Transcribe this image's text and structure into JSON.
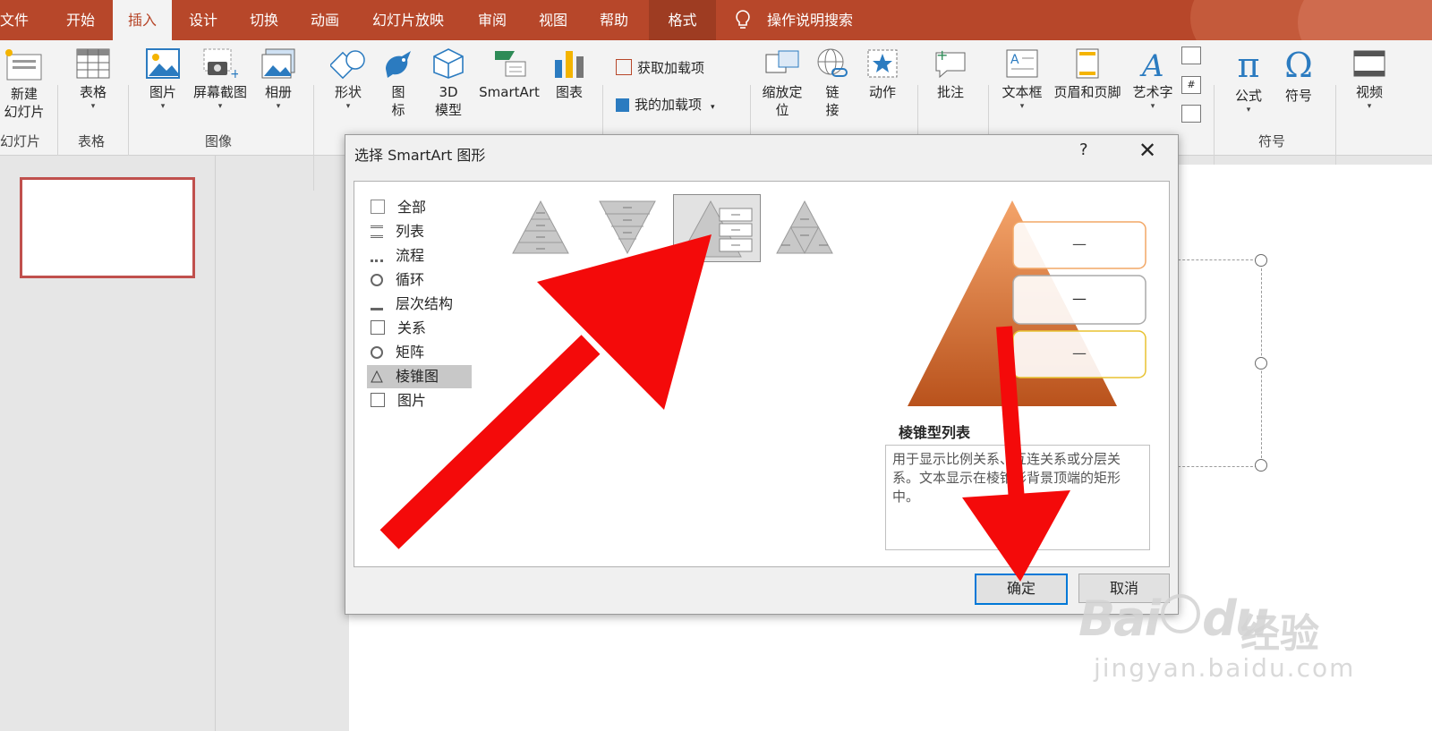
{
  "menubar": {
    "tabs": [
      "文件",
      "开始",
      "插入",
      "设计",
      "切换",
      "动画",
      "幻灯片放映",
      "审阅",
      "视图",
      "帮助",
      "格式"
    ],
    "active_tab": "插入",
    "search": "操作说明搜索"
  },
  "ribbon": {
    "new_slide": [
      "新建",
      "幻灯片"
    ],
    "table": "表格",
    "picture": "图片",
    "screenshot": "屏幕截图",
    "album": "相册",
    "shape": "形状",
    "icon": [
      "图",
      "标"
    ],
    "model3d": [
      "3D",
      "模型"
    ],
    "smartart": "SmartArt",
    "chart": "图表",
    "get_addins": "获取加载项",
    "my_addins": "我的加载项",
    "zoom": [
      "缩放定",
      "位"
    ],
    "link": [
      "链",
      "接"
    ],
    "action": "动作",
    "comment": "批注",
    "textbox": "文本框",
    "header_footer": "页眉和页脚",
    "wordart": "艺术字",
    "equation": "公式",
    "symbol": "符号",
    "video": "视频",
    "groups": {
      "slides": "幻灯片",
      "table": "表格",
      "images": "图像",
      "symbols": "符号"
    }
  },
  "dialog": {
    "title": "选择 SmartArt 图形",
    "help": "?",
    "close": "✕",
    "categories": [
      "全部",
      "列表",
      "流程",
      "循环",
      "层次结构",
      "关系",
      "矩阵",
      "棱锥图",
      "图片"
    ],
    "selected_category": "棱锥图",
    "preview_title": "棱锥型列表",
    "preview_desc": "用于显示比例关系、互连关系或分层关系。文本显示在棱锥形背景顶端的矩形中。",
    "preview_items": [
      "—",
      "—",
      "—"
    ],
    "ok": "确定",
    "cancel": "取消"
  },
  "watermark": {
    "logo": "Bai",
    "logo2": "du",
    "cn": "经验",
    "url": "jingyan.baidu.com"
  },
  "colors": {
    "accent": "#b7472a",
    "selection": "#0078d7",
    "arrow": "#f40a0a"
  }
}
